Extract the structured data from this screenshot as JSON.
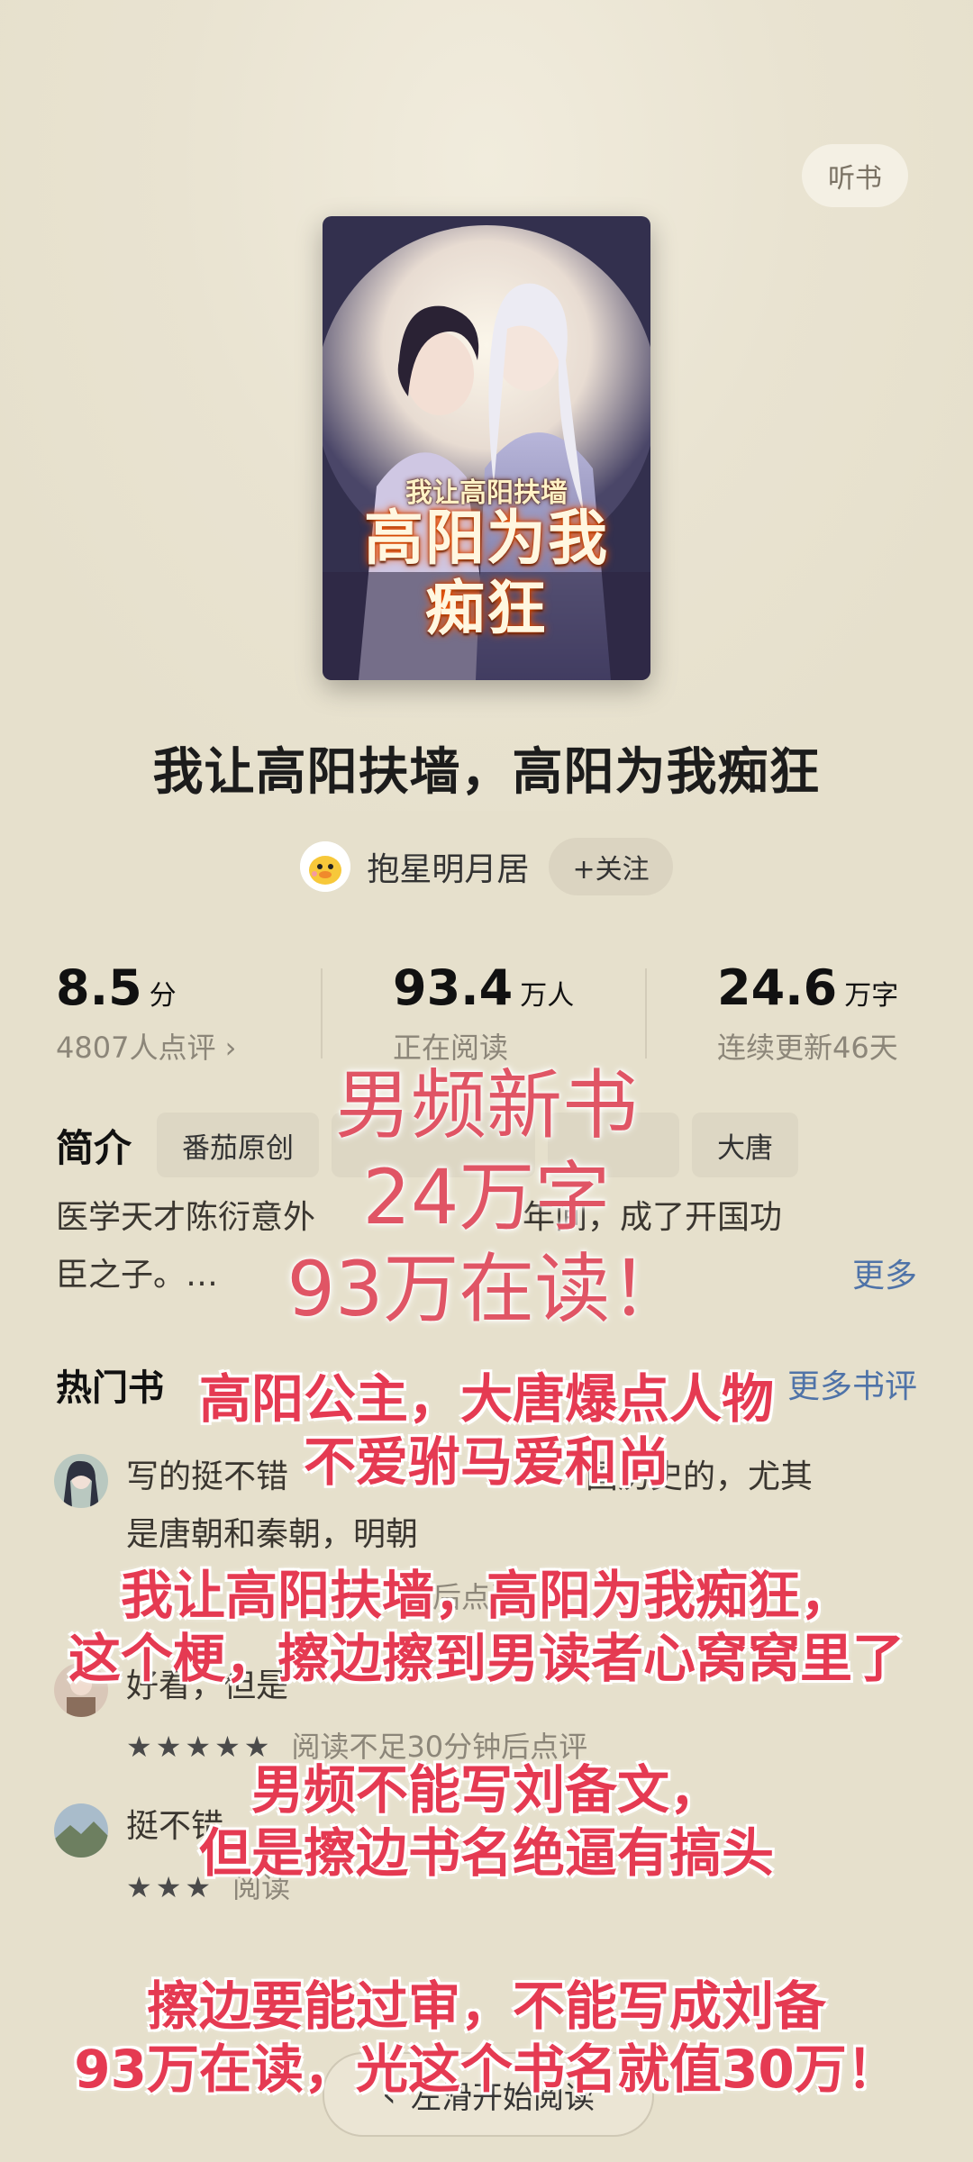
{
  "header": {
    "listen_label": "听书"
  },
  "cover": {
    "top_text": "我让高阳扶墙",
    "main_line1": "高阳为我",
    "main_line2": "痴狂"
  },
  "book": {
    "title": "我让高阳扶墙，高阳为我痴狂",
    "author": "抱星明月居",
    "follow_label": "+关注"
  },
  "stats": {
    "score": "8.5",
    "score_unit": "分",
    "score_sub": "4807人点评 ›",
    "readers": "93.4",
    "readers_unit": "万人",
    "readers_sub": "正在阅读",
    "words": "24.6",
    "words_unit": "万字",
    "words_sub": "连续更新46天"
  },
  "intro": {
    "title": "简介",
    "tags": [
      "番茄原创",
      "",
      "",
      "大唐"
    ],
    "text_line1": "医学天才陈衍意外",
    "text_line1_end": "年间，成了开国功",
    "text_line2": "臣之子。…",
    "more_label": "更多"
  },
  "hot_reviews": {
    "title": "热门书",
    "more_label": "更多书评",
    "items": [
      {
        "text_start": "写的挺不错",
        "text_end": "国历史的，尤其",
        "text_line2": "是唐朝和秦朝，明朝",
        "meta": "后点评",
        "stars": ""
      },
      {
        "text_start": "好看，但是",
        "text_end": "",
        "text_line2": "",
        "meta": "阅读不足30分钟后点评",
        "stars": "★★★★★"
      },
      {
        "text_start": "挺不错",
        "text_end": "",
        "text_line2": "",
        "meta": "阅读",
        "stars": "★★★"
      }
    ]
  },
  "bottom": {
    "read_label": "左滑开始阅读",
    "arrow": "‹"
  },
  "overlay": {
    "big1": "男频新书",
    "big2": "24万字",
    "big3": "93万在读！",
    "m1": "高阳公主，大唐爆点人物",
    "m2": "不爱驸马爱和尚",
    "m3": "我让高阳扶墙，高阳为我痴狂，",
    "m4": "这个梗，擦边擦到男读者心窝窝里了",
    "m5": "男频不能写刘备文，",
    "m6": "但是擦边书名绝逼有搞头",
    "m7": "擦边要能过审，不能写成刘备",
    "m8": "93万在读，光这个书名就值30万！"
  },
  "colors": {
    "background": "#e6e0cc",
    "link": "#4f73a8",
    "overlay_text": "#e53a52"
  }
}
